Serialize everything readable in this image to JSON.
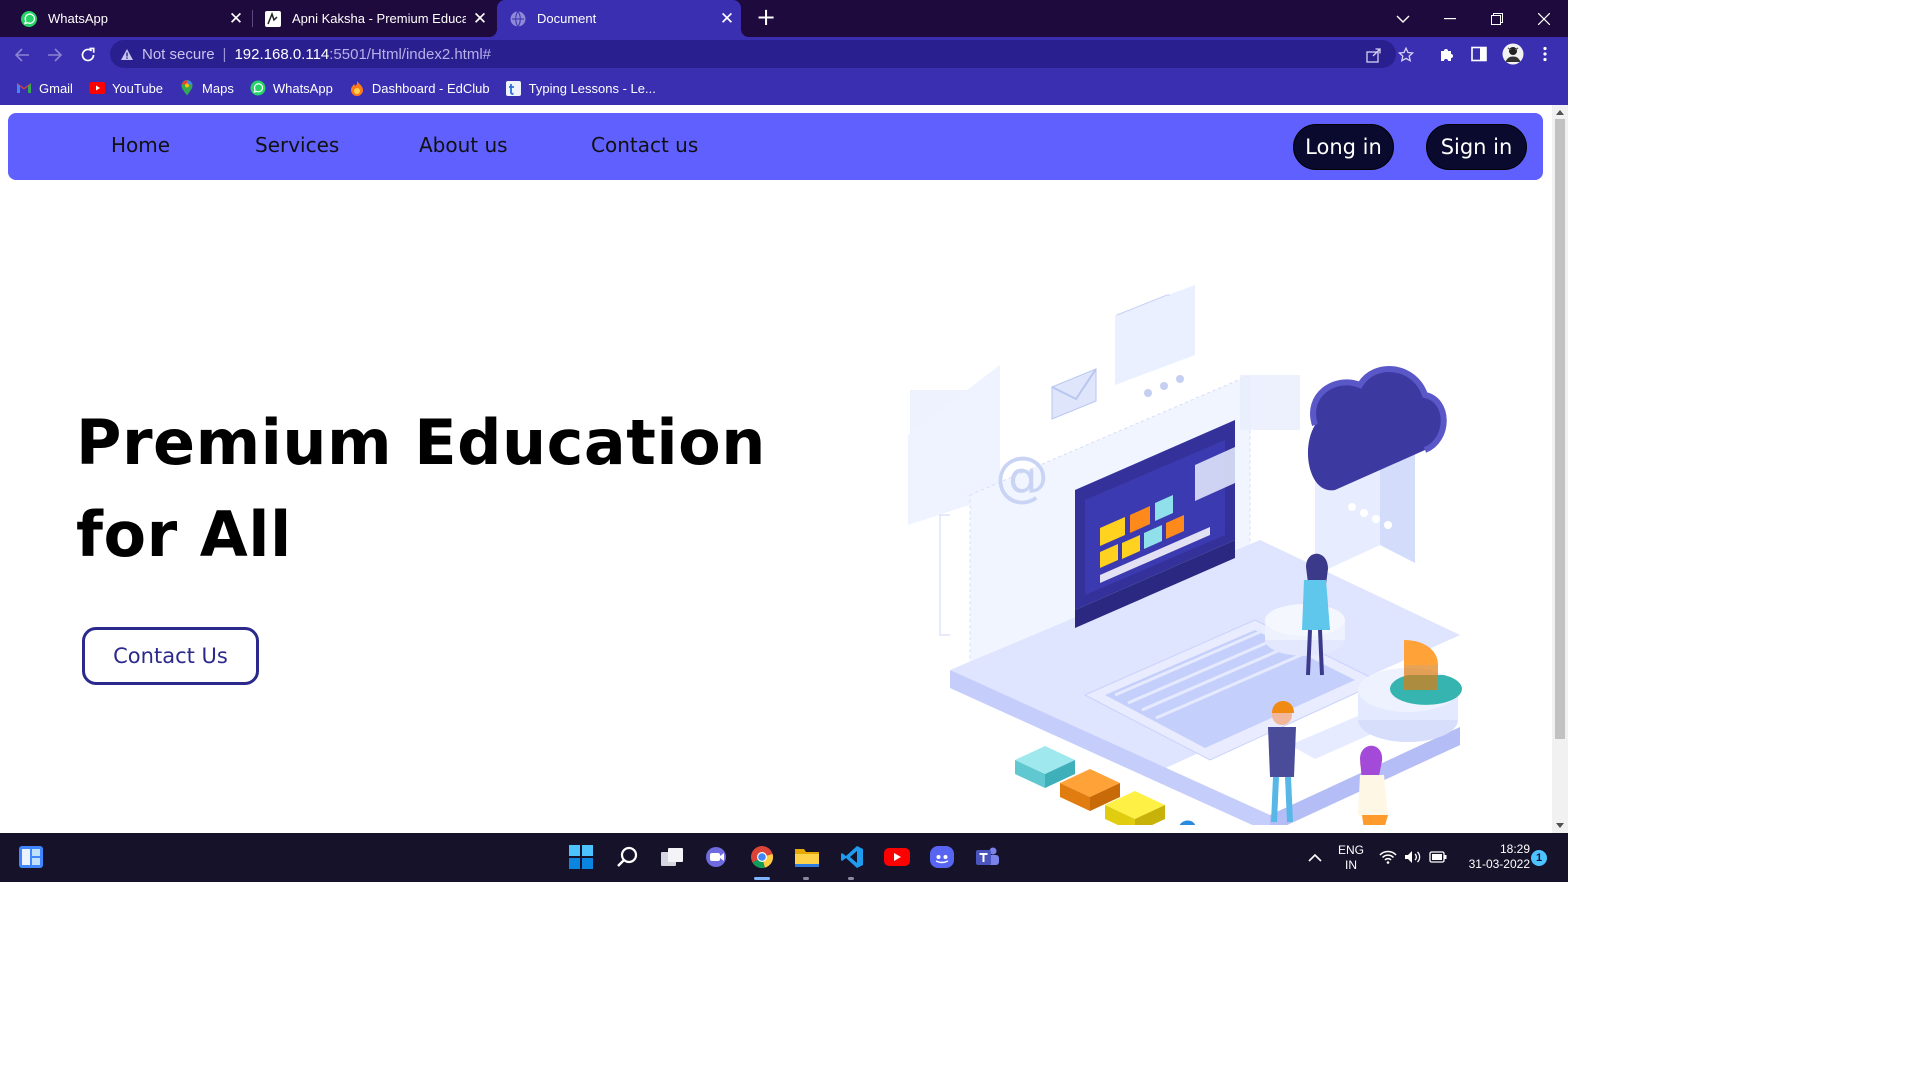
{
  "browser": {
    "tabs": [
      {
        "title": "WhatsApp",
        "icon": "whatsapp-icon",
        "active": false
      },
      {
        "title": "Apni Kaksha - Premium Education",
        "icon": "apni-kaksha-icon",
        "active": false
      },
      {
        "title": "Document",
        "icon": "globe-icon",
        "active": true
      }
    ],
    "address": {
      "security_label": "Not secure",
      "host": "192.168.0.114",
      "path": ":5501/Html/index2.html#"
    },
    "bookmarks": [
      {
        "label": "Gmail",
        "icon": "gmail-icon"
      },
      {
        "label": "YouTube",
        "icon": "youtube-icon"
      },
      {
        "label": "Maps",
        "icon": "maps-icon"
      },
      {
        "label": "WhatsApp",
        "icon": "whatsapp-icon"
      },
      {
        "label": "Dashboard - EdClub",
        "icon": "edclub-icon"
      },
      {
        "label": "Typing Lessons - Le...",
        "icon": "typing-icon"
      }
    ]
  },
  "site": {
    "nav": {
      "links": [
        "Home",
        "Services",
        "About us",
        "Contact us"
      ],
      "login_label": "Long in",
      "signin_label": "Sign in"
    },
    "hero": {
      "title_line1": "Premium Education",
      "title_line2": "for All",
      "cta_label": "Contact Us"
    }
  },
  "taskbar": {
    "apps": [
      "start-icon",
      "search-icon",
      "task-view-icon",
      "teams-chat-icon",
      "chrome-icon",
      "file-explorer-icon",
      "vscode-icon",
      "youtube-icon",
      "discord-icon",
      "teams-icon"
    ],
    "language_line1": "ENG",
    "language_line2": "IN",
    "time": "18:29",
    "date": "31-03-2022",
    "notification_count": "1"
  },
  "colors": {
    "tabstrip": "#1e0a3c",
    "chrome": "#3a2fb0",
    "site_nav": "#6060ff",
    "pill": "#0a0a2e",
    "cta_border": "#2b2a8c"
  }
}
